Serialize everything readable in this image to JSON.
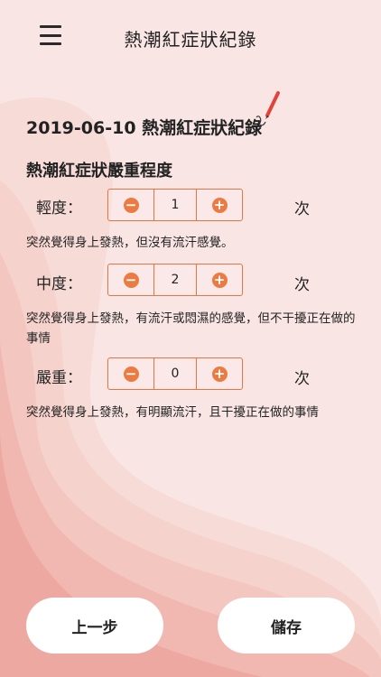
{
  "header": {
    "title": "熱潮紅症狀紀錄",
    "menu_icon": "hamburger-menu-icon"
  },
  "record": {
    "heading": "2019-06-10 熱潮紅症狀紀錄",
    "edit_icon": "pencil-icon"
  },
  "severity": {
    "title": "熱潮紅症狀嚴重程度",
    "rows": [
      {
        "label": "輕度：",
        "value": "1",
        "unit": "次",
        "description": "突然覺得身上發熱，但沒有流汗感覺。"
      },
      {
        "label": "中度：",
        "value": "2",
        "unit": "次",
        "description": "突然覺得身上發熱，有流汗或悶濕的感覺，但不干擾正在做的事情"
      },
      {
        "label": "嚴重：",
        "value": "0",
        "unit": "次",
        "description": "突然覺得身上發熱，有明顯流汗，且干擾正在做的事情"
      }
    ]
  },
  "footer": {
    "prev_label": "上一步",
    "save_label": "儲存"
  },
  "colors": {
    "accent": "#ec7b42",
    "background": "#f9e6e4",
    "button": "#ffffff"
  }
}
